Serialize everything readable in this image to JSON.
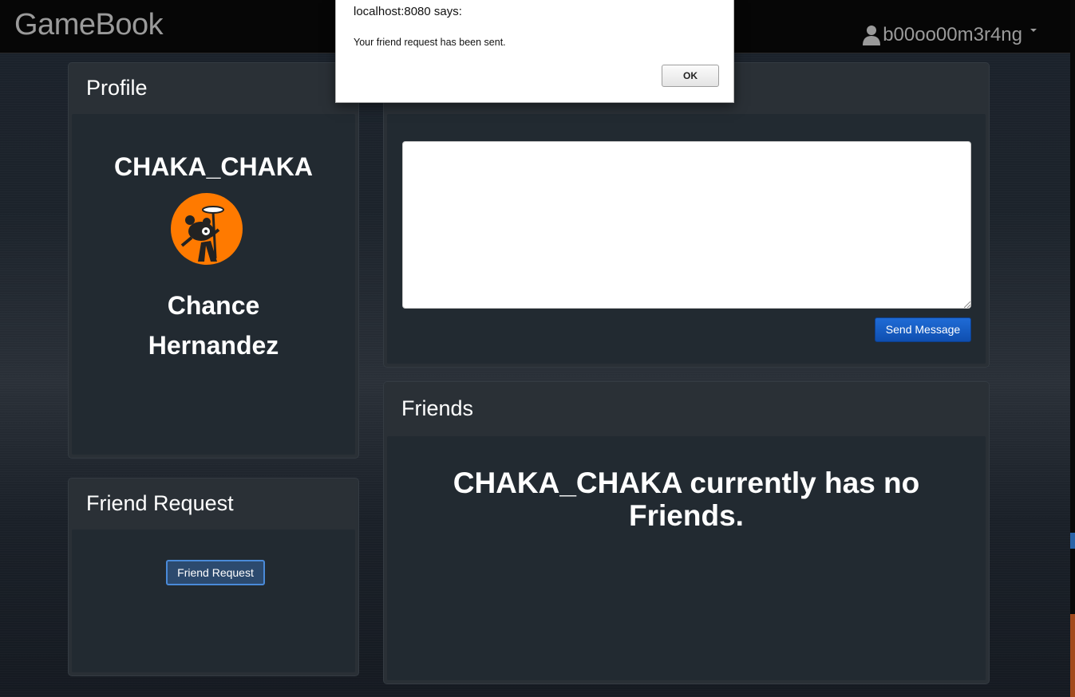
{
  "navbar": {
    "brand": "GameBook",
    "username": "b00oo00m3r4ng"
  },
  "profile": {
    "heading": "Profile",
    "username": "CHAKA_CHAKA",
    "first_name": "Chance",
    "last_name": "Hernandez",
    "avatar_color": "#ff7a00"
  },
  "friend_request": {
    "heading": "Friend Request",
    "button_label": "Friend Request"
  },
  "message": {
    "textarea_value": "",
    "send_label": "Send Message"
  },
  "friends": {
    "heading": "Friends",
    "empty_text": "CHAKA_CHAKA currently has no Friends."
  },
  "dialog": {
    "title": "localhost:8080 says:",
    "message": "Your friend request has been sent.",
    "ok_label": "OK"
  },
  "colors": {
    "primary_button": "#1559c4",
    "panel": "#2a3036"
  }
}
